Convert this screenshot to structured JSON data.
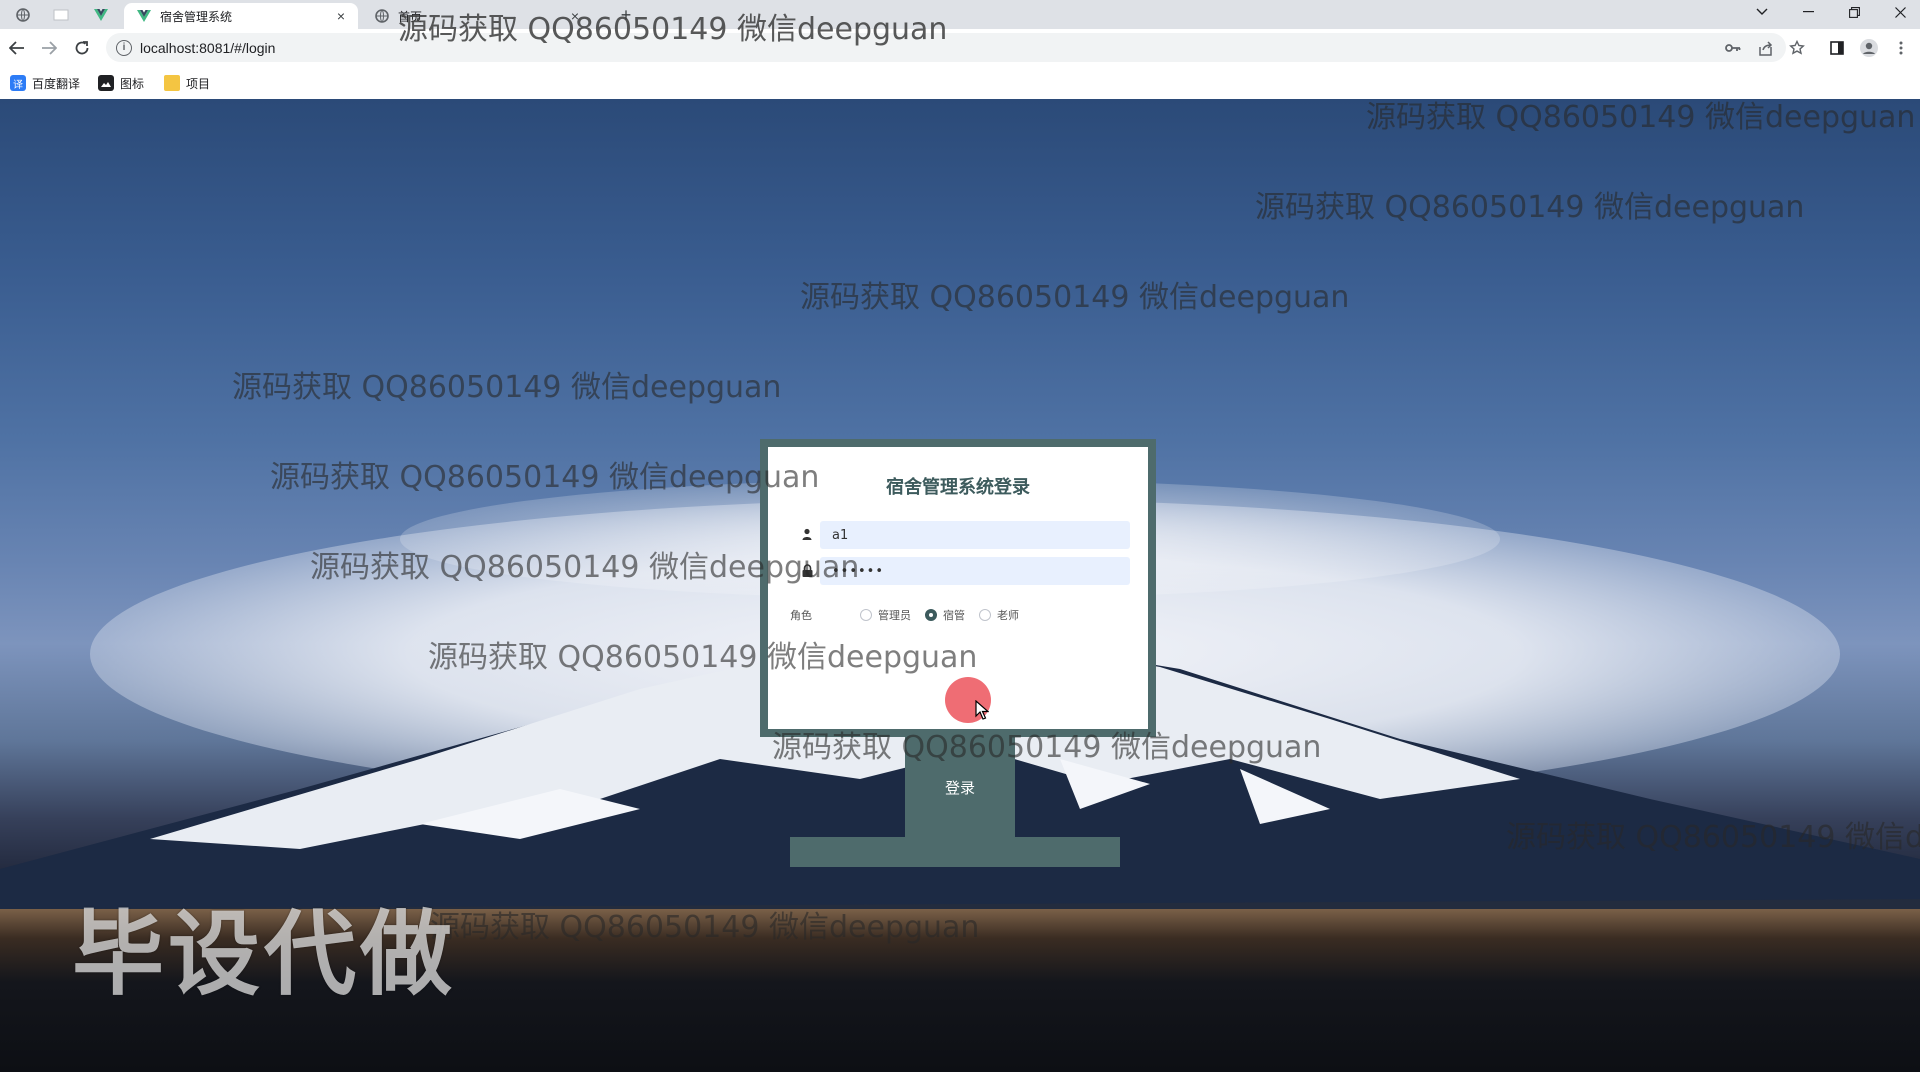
{
  "browser": {
    "tabs": [
      {
        "title": "宿舍管理系统",
        "active": true,
        "icon": "vue-logo-icon"
      },
      {
        "title": "首页",
        "active": false,
        "icon": "globe-icon"
      }
    ],
    "close_glyph": "×",
    "new_tab_glyph": "+",
    "url": "localhost:8081/#/login",
    "bookmarks": [
      {
        "label": "百度翻译",
        "icon": "translate-icon",
        "color": "#2d7cf6"
      },
      {
        "label": "图标",
        "icon": "image-icon",
        "color": "#202124"
      },
      {
        "label": "项目",
        "icon": "folder-icon",
        "color": "#f4c542"
      }
    ]
  },
  "login": {
    "title": "宿舍管理系统登录",
    "username_value": "a1",
    "password_value": "••••••",
    "role_label": "角色",
    "roles": [
      {
        "label": "管理员",
        "checked": false
      },
      {
        "label": "宿管",
        "checked": true
      },
      {
        "label": "老师",
        "checked": false
      }
    ],
    "submit_label": "登录"
  },
  "watermark": {
    "text": "源码获取 QQ86050149 微信deepguan",
    "partial_text": "源码获取 QQ86050149 微信de",
    "stamp": "毕设代做"
  },
  "colors": {
    "accent": "#4e6b6c",
    "title": "#3d5b5d",
    "input_bg": "#e8f0fe",
    "click_marker": "#ec545c"
  }
}
